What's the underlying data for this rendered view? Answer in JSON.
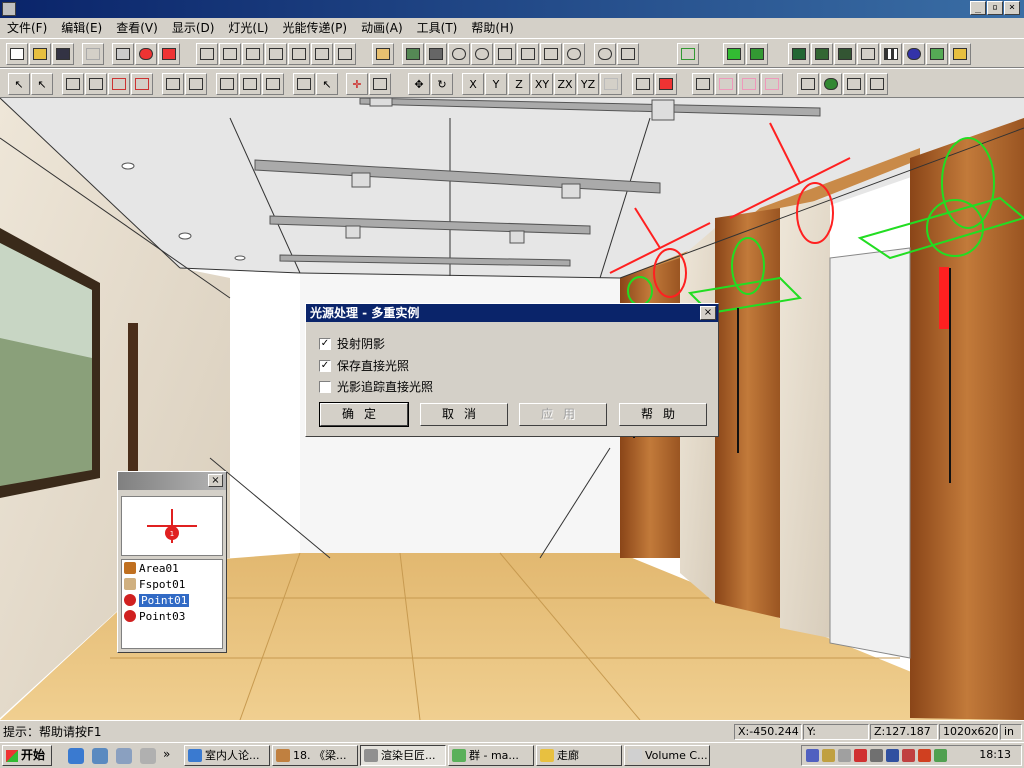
{
  "window": {
    "title": "",
    "controls": {
      "minimize": "_",
      "maximize": "▫",
      "close": "×"
    }
  },
  "menu": {
    "items": [
      {
        "label": "文件(F)"
      },
      {
        "label": "编辑(E)"
      },
      {
        "label": "查看(V)"
      },
      {
        "label": "显示(D)"
      },
      {
        "label": "灯光(L)"
      },
      {
        "label": "光能传递(P)"
      },
      {
        "label": "动画(A)"
      },
      {
        "label": "工具(T)"
      },
      {
        "label": "帮助(H)"
      }
    ]
  },
  "toolbar2": {
    "axis_x": "X",
    "axis_y": "Y",
    "axis_z": "Z",
    "plane_xy": "XY",
    "plane_zx": "ZX",
    "plane_yz": "YZ"
  },
  "dialog": {
    "title": "光源处理 - 多重实例",
    "close": "×",
    "options": [
      {
        "label": "投射阴影",
        "checked": true
      },
      {
        "label": "保存直接光照",
        "checked": true
      },
      {
        "label": "光影追踪直接光照",
        "checked": false
      }
    ],
    "buttons": {
      "ok": "确定",
      "cancel": "取消",
      "apply": "应用",
      "help": "帮助"
    },
    "check_mark": "✓"
  },
  "light_panel": {
    "title": "",
    "close": "×",
    "preview_badge": "1",
    "lights": [
      {
        "name": "Area01",
        "icon": "area-light-icon",
        "color": "#c07020",
        "selected": false
      },
      {
        "name": "Fspot01",
        "icon": "spot-light-icon",
        "color": "#d0b080",
        "selected": false
      },
      {
        "name": "Point01",
        "icon": "point-light-icon",
        "color": "#d02020",
        "selected": true
      },
      {
        "name": "Point03",
        "icon": "point-light-icon",
        "color": "#d02020",
        "selected": false
      }
    ]
  },
  "status": {
    "hint": "提示：帮助请按F1",
    "x": "X:-450.244",
    "y": "Y:",
    "z": "Z:127.187",
    "resolution": "1020x620",
    "unit": "in"
  },
  "taskbar": {
    "start_label": "开始",
    "more": "»",
    "tasks": [
      {
        "label": "室内人论...",
        "active": false
      },
      {
        "label": "18. 《梁...",
        "active": false
      },
      {
        "label": "渲染巨匠...",
        "active": true
      },
      {
        "label": "群 - ma...",
        "active": false
      },
      {
        "label": "走廊",
        "active": false
      },
      {
        "label": "Volume C...",
        "active": false
      }
    ],
    "clock": "18:13"
  },
  "colors": {
    "accent": "#0a246a",
    "selection": "#316ac5",
    "face": "#d4d0c8",
    "light_red": "#ff2020",
    "light_green": "#22dd22",
    "wood": "#b8672a",
    "floor": "#e2b870"
  }
}
